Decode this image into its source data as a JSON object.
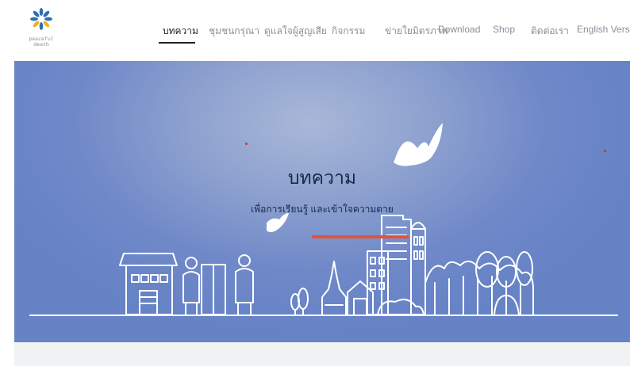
{
  "brand": {
    "logo_text_line1": "peaceful",
    "logo_text_line2": "death",
    "colors": {
      "petals_blue": "#2f6db3",
      "petals_yellow": "#f2b01e"
    }
  },
  "nav": {
    "items": [
      {
        "label": "บทความ",
        "active": true
      },
      {
        "label": "ชุมชนกรุณา",
        "active": false
      },
      {
        "label": "ดูแลใจผู้สูญเสีย",
        "active": false
      },
      {
        "label": "กิจกรรม",
        "active": false
      },
      {
        "label": "ข่ายใยมิตรภาพ",
        "active": false
      },
      {
        "label": "Download",
        "active": false
      },
      {
        "label": "Shop",
        "active": false
      },
      {
        "label": "ติดต่อเรา",
        "active": false
      },
      {
        "label": "English Version",
        "active": false
      }
    ]
  },
  "hero": {
    "title": "บทความ",
    "subtitle": "เพื่อการเรียนรู้ และเข้าใจความตาย",
    "colors": {
      "background": "#6f88c8",
      "accent_bar": "#e2533c",
      "line_art": "#ffffff"
    }
  }
}
